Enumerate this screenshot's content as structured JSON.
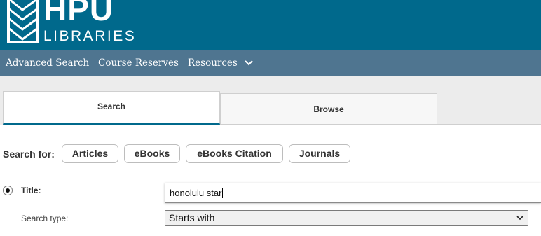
{
  "header": {
    "logo_title": "HPU",
    "logo_subtitle": "LIBRARIES",
    "logo_icon": "hpu-diamond-icon",
    "background_color": "#00698c"
  },
  "nav": {
    "items": [
      {
        "label": "Advanced Search"
      },
      {
        "label": "Course Reserves"
      },
      {
        "label": "Resources",
        "icon": "chevron-down-icon"
      }
    ],
    "background_color": "#4f7590"
  },
  "tabs": [
    {
      "label": "Search",
      "active": true
    },
    {
      "label": "Browse",
      "active": false
    }
  ],
  "search_for": {
    "label": "Search for:",
    "options": [
      {
        "label": "Articles"
      },
      {
        "label": "eBooks"
      },
      {
        "label": "eBooks Citation"
      },
      {
        "label": "Journals"
      }
    ]
  },
  "title_field": {
    "label": "Title:",
    "selected": true,
    "value": "honolulu star"
  },
  "search_type": {
    "label": "Search type:",
    "selected_value": "Starts with"
  }
}
